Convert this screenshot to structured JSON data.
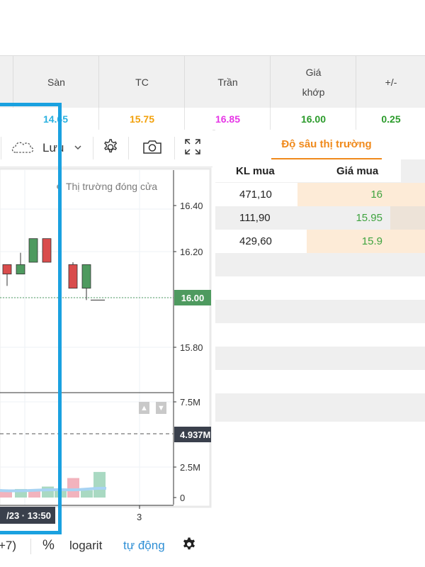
{
  "header": {
    "columns": [
      {
        "label": "Sàn"
      },
      {
        "label": "TC"
      },
      {
        "label": "Trần"
      },
      {
        "label": "Giá\nkhớp"
      },
      {
        "label": "+/-"
      }
    ],
    "values": [
      {
        "value": "14.65",
        "color": "#2ab1e0"
      },
      {
        "value": "15.75",
        "color": "#f2a10c"
      },
      {
        "value": "16.85",
        "color": "#e637e6"
      },
      {
        "value": "16.00",
        "color": "#2b9b2b"
      },
      {
        "value": "0.25",
        "color": "#2b9b2b"
      }
    ]
  },
  "toolbar": {
    "save_label": "Lưu",
    "icons": [
      "cloud-icon",
      "chevron-down-icon",
      "settings-gear-icon",
      "camera-icon",
      "fullscreen-icon"
    ]
  },
  "chart": {
    "status": "Thị trường đóng cửa",
    "price_labels": [
      "16.40",
      "16.20",
      "15.80"
    ],
    "last_price": "16.00",
    "volume_labels": [
      "7.5M",
      "2.5M",
      "0"
    ],
    "last_volume": "4.937M",
    "time_label": "/23 · 13:50",
    "x_tick": "3",
    "colors": {
      "up": "#4e9a5f",
      "down": "#d94c4c",
      "up_vol": "#a9d9c2",
      "down_vol": "#f2b3bd",
      "ma": "#a7d3f3"
    }
  },
  "chart_data": {
    "type": "candlestick",
    "candles": [
      {
        "open": 16.15,
        "close": 16.11,
        "high": 16.15,
        "low": 16.06,
        "dir": "down"
      },
      {
        "open": 16.11,
        "close": 16.15,
        "high": 16.2,
        "low": 16.11,
        "dir": "up"
      },
      {
        "open": 16.16,
        "close": 16.26,
        "high": 16.26,
        "low": 16.16,
        "dir": "up"
      },
      {
        "open": 16.26,
        "close": 16.16,
        "high": 16.26,
        "low": 16.16,
        "dir": "down"
      },
      {
        "open": 16.15,
        "close": 16.05,
        "high": 16.16,
        "low": 16.05,
        "dir": "down"
      },
      {
        "open": 16.05,
        "close": 16.15,
        "high": 16.15,
        "low": 16.0,
        "dir": "up"
      }
    ],
    "volumes": [
      0.6,
      0.7,
      0.5,
      0.9,
      0.7,
      1.6,
      0.6,
      2.1
    ]
  },
  "bottom_bar": {
    "timezone": "+7)",
    "percent": "%",
    "log": "logarit",
    "auto": "tự động"
  },
  "orderbook": {
    "tab": "Độ sâu thị trường",
    "col_vol": "KL mua",
    "col_price": "Giá mua",
    "rows": [
      {
        "vol": "471,10",
        "price": "16"
      },
      {
        "vol": "111,90",
        "price": "15.95"
      },
      {
        "vol": "429,60",
        "price": "15.9"
      }
    ]
  }
}
